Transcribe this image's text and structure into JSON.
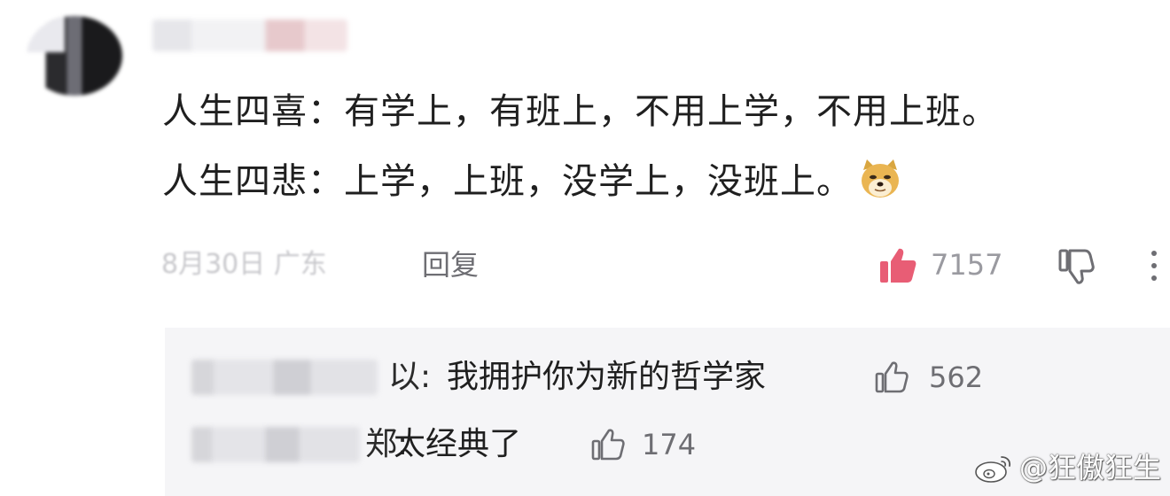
{
  "comment": {
    "author": "",
    "line1": "人生四喜：有学上，有班上，不用上学，不用上班。",
    "line2": "人生四悲：上学，上班，没学上，没班上。",
    "emoji_icon": "doge-emoji",
    "date_location": "8月30日 广东",
    "reply_label": "回复",
    "like_count": "7157",
    "like_color": "#e85d75"
  },
  "replies": [
    {
      "name_tail": "以:",
      "text": "我拥护你为新的哲学家",
      "like_count": "562"
    },
    {
      "name_tail": "郑:",
      "text": "太经典了",
      "like_count": "174"
    }
  ],
  "watermark": {
    "text": "@狂傲狂生",
    "icon": "weibo-logo-icon"
  }
}
